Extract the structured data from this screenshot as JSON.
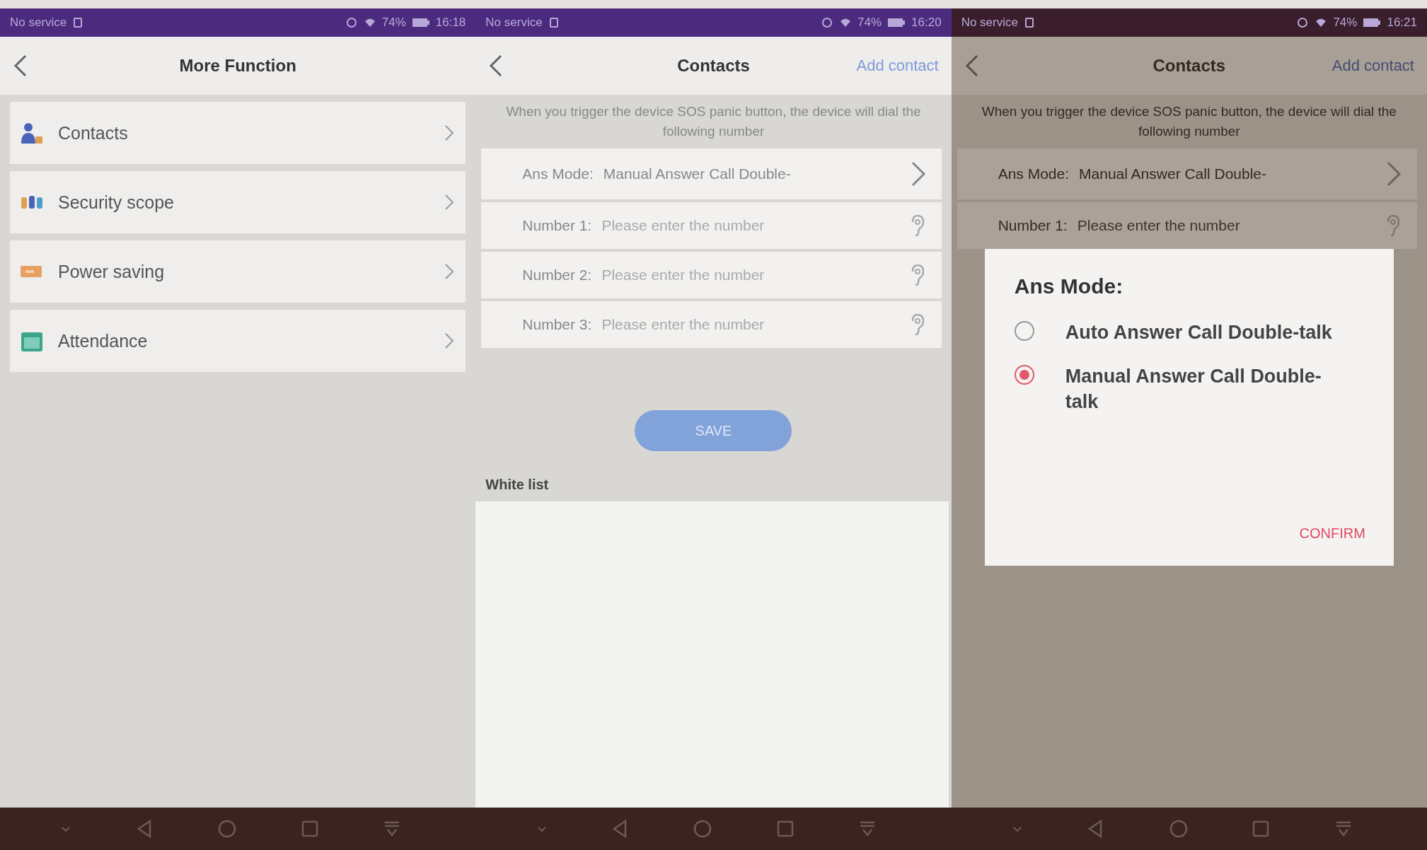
{
  "screens": [
    {
      "kind": "menu",
      "status_bar": {
        "carrier": "No service",
        "battery": "74%",
        "time": "16:18"
      },
      "header": {
        "title": "More Function"
      },
      "items": [
        {
          "label": "Contacts",
          "kind": "contacts"
        },
        {
          "label": "Security scope",
          "kind": "scope"
        },
        {
          "label": "Power saving",
          "kind": "power"
        },
        {
          "label": "Attendance",
          "kind": "attendance"
        }
      ]
    },
    {
      "kind": "contacts",
      "status_bar": {
        "carrier": "No service",
        "battery": "74%",
        "time": "16:20"
      },
      "header": {
        "title": "Contacts",
        "action": "Add contact"
      },
      "notice": "When you trigger the device SOS panic button, the device will dial the following number",
      "ans_mode": {
        "label": "Ans Mode:",
        "value": "Manual Answer Call Double-"
      },
      "numbers": [
        {
          "label": "Number 1:",
          "placeholder": "Please enter the number"
        },
        {
          "label": "Number 2:",
          "placeholder": "Please enter the number"
        },
        {
          "label": "Number 3:",
          "placeholder": "Please enter the number"
        }
      ],
      "save_button": "SAVE",
      "white_list": {
        "title": "White list"
      }
    },
    {
      "kind": "contacts",
      "status_bar": {
        "carrier": "No service",
        "battery": "74%",
        "time": "16:21"
      },
      "header": {
        "title": "Contacts",
        "action": "Add contact"
      },
      "notice": "When you trigger the device SOS panic button, the device will dial the following number",
      "ans_mode": {
        "label": "Ans Mode:",
        "value": "Manual Answer Call Double-"
      },
      "numbers": [
        {
          "label": "Number 1:",
          "placeholder": "Please enter the number"
        }
      ],
      "dialog": {
        "title": "Ans Mode:",
        "options": [
          {
            "label": "Auto Answer Call Double-talk",
            "selected": false
          },
          {
            "label": "Manual Answer Call Double-talk",
            "selected": true
          }
        ],
        "confirm": "CONFIRM"
      }
    }
  ]
}
